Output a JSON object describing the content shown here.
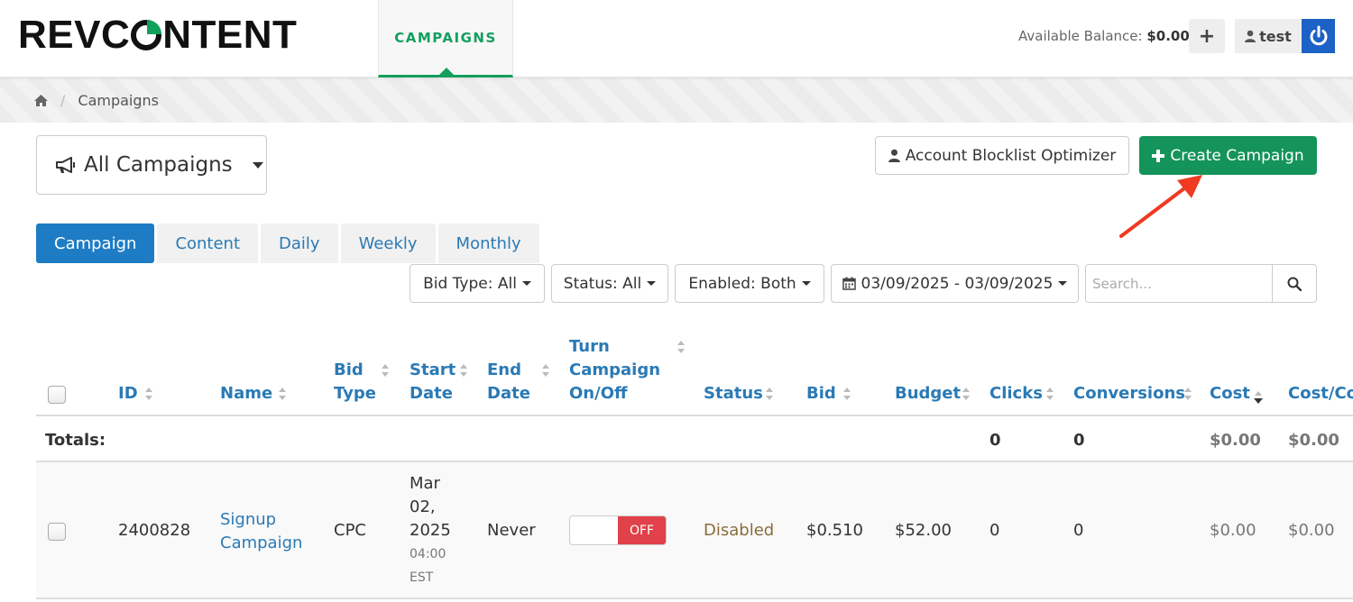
{
  "header": {
    "logo_text": "REVCONTENT",
    "nav_tab": "CAMPAIGNS",
    "balance_label": "Available Balance:",
    "balance_value": "$0.00",
    "plus_label": "+",
    "user_label": "test",
    "colors": {
      "accent_green": "#149e5e",
      "power_blue": "#1c61c6"
    }
  },
  "breadcrumb": {
    "current": "Campaigns"
  },
  "toolbar": {
    "campaign_select": "All Campaigns",
    "blocklist_label": "Account Blocklist Optimizer",
    "create_label": "Create Campaign"
  },
  "tabs": [
    "Campaign",
    "Content",
    "Daily",
    "Weekly",
    "Monthly"
  ],
  "filters": {
    "bid_type": "Bid Type: All",
    "status": "Status: All",
    "enabled": "Enabled: Both",
    "date_range": "03/09/2025 - 03/09/2025",
    "search_placeholder": "Search..."
  },
  "table": {
    "headers": {
      "id": "ID",
      "name": "Name",
      "bid_type_1": "Bid",
      "bid_type_2": "Type",
      "start_1": "Start",
      "start_2": "Date",
      "end_1": "End",
      "end_2": "Date",
      "turn_1": "Turn",
      "turn_2": "Campaign",
      "turn_3": "On/Off",
      "status": "Status",
      "bid": "Bid",
      "budget": "Budget",
      "clicks": "Clicks",
      "conversions": "Conversions",
      "cost": "Cost",
      "cost_per": "Cost/Con"
    },
    "totals": {
      "label": "Totals:",
      "clicks": "0",
      "conversions": "0",
      "cost": "$0.00",
      "cost_per": "$0.00"
    },
    "rows": [
      {
        "id": "2400828",
        "name_1": "Signup",
        "name_2": "Campaign",
        "bid_type": "CPC",
        "start_1": "Mar",
        "start_2": "02,",
        "start_3": "2025",
        "start_4": "04:00",
        "start_5": "EST",
        "end": "Never",
        "toggle": "OFF",
        "status": "Disabled",
        "bid": "$0.510",
        "budget": "$52.00",
        "clicks": "0",
        "conversions": "0",
        "cost": "$0.00",
        "cost_per": "$0.00"
      }
    ]
  }
}
